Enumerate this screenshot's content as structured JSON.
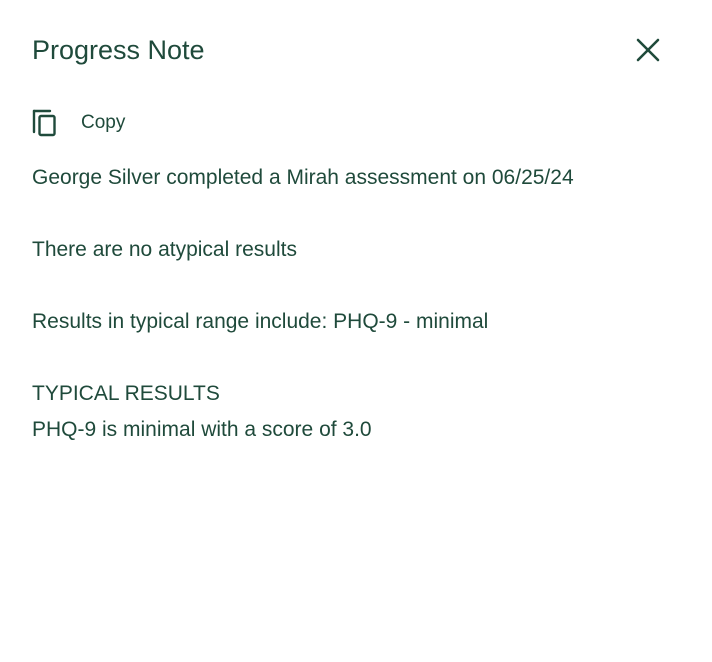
{
  "panel": {
    "title": "Progress Note",
    "close_icon": "close-icon"
  },
  "copy": {
    "icon": "copy-icon",
    "label": "Copy"
  },
  "note": {
    "line1": "George Silver completed a Mirah assessment on 06/25/24",
    "line2": "There are no atypical results",
    "line3": "Results in typical range include: PHQ-9 - minimal",
    "section_heading": "TYPICAL RESULTS",
    "line4": "PHQ-9 is minimal with a score of 3.0"
  },
  "colors": {
    "text": "#1f4a3b",
    "background": "#ffffff"
  }
}
